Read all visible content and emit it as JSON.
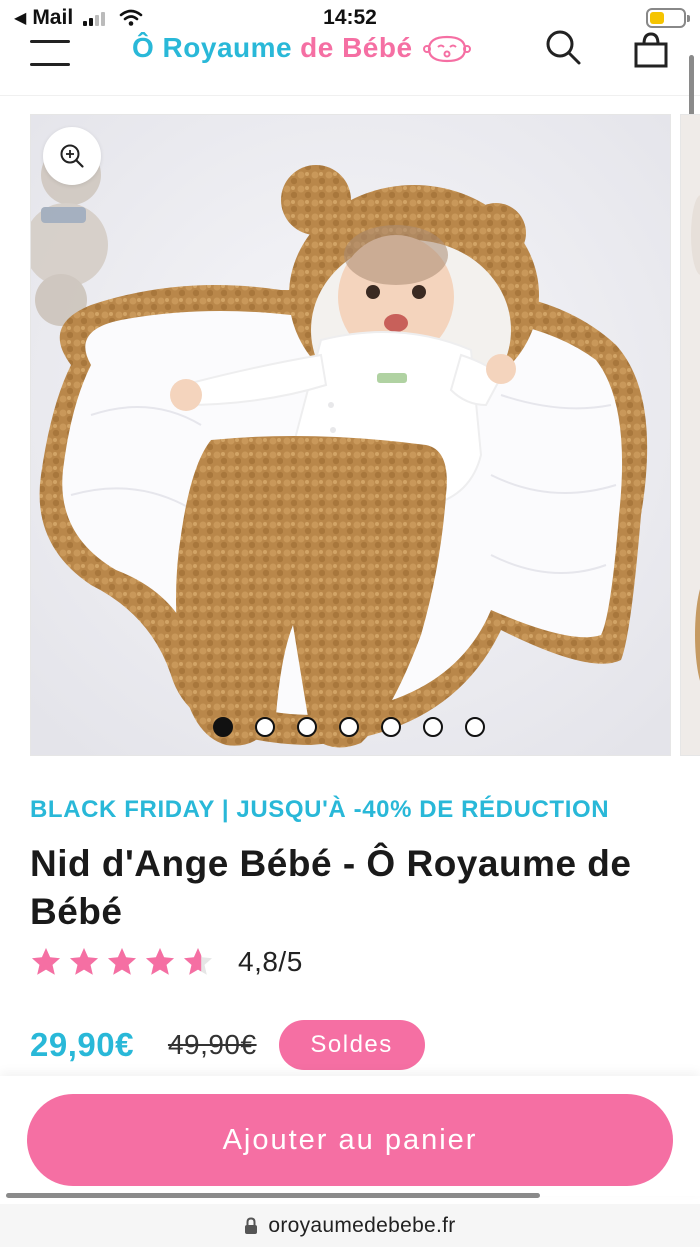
{
  "status_bar": {
    "carrier": "Mail",
    "time": "14:52",
    "battery_level": 0.45
  },
  "header": {
    "logo_part1": "Ô Royaume",
    "logo_part2": "de Bébé",
    "icons": [
      "menu-icon",
      "search-icon",
      "cart-icon"
    ]
  },
  "gallery": {
    "image_count": 7,
    "active_index": 0,
    "zoom_icon": "zoom-in-icon"
  },
  "product": {
    "promo": "BLACK FRIDAY | JUSQU'À -40% DE RÉDUCTION",
    "title": "Nid d'Ange Bébé - Ô Royaume de Bébé",
    "rating_value": 4.8,
    "rating_text": "4,8/5",
    "price": "29,90€",
    "old_price": "49,90€",
    "badge": "Soldes"
  },
  "cta": {
    "add_to_cart": "Ajouter au panier"
  },
  "browser": {
    "url": "oroyaumedebebe.fr"
  },
  "colors": {
    "brand_blue": "#29b8d8",
    "brand_pink": "#f56fa3",
    "text_dark": "#1a1a1a"
  }
}
